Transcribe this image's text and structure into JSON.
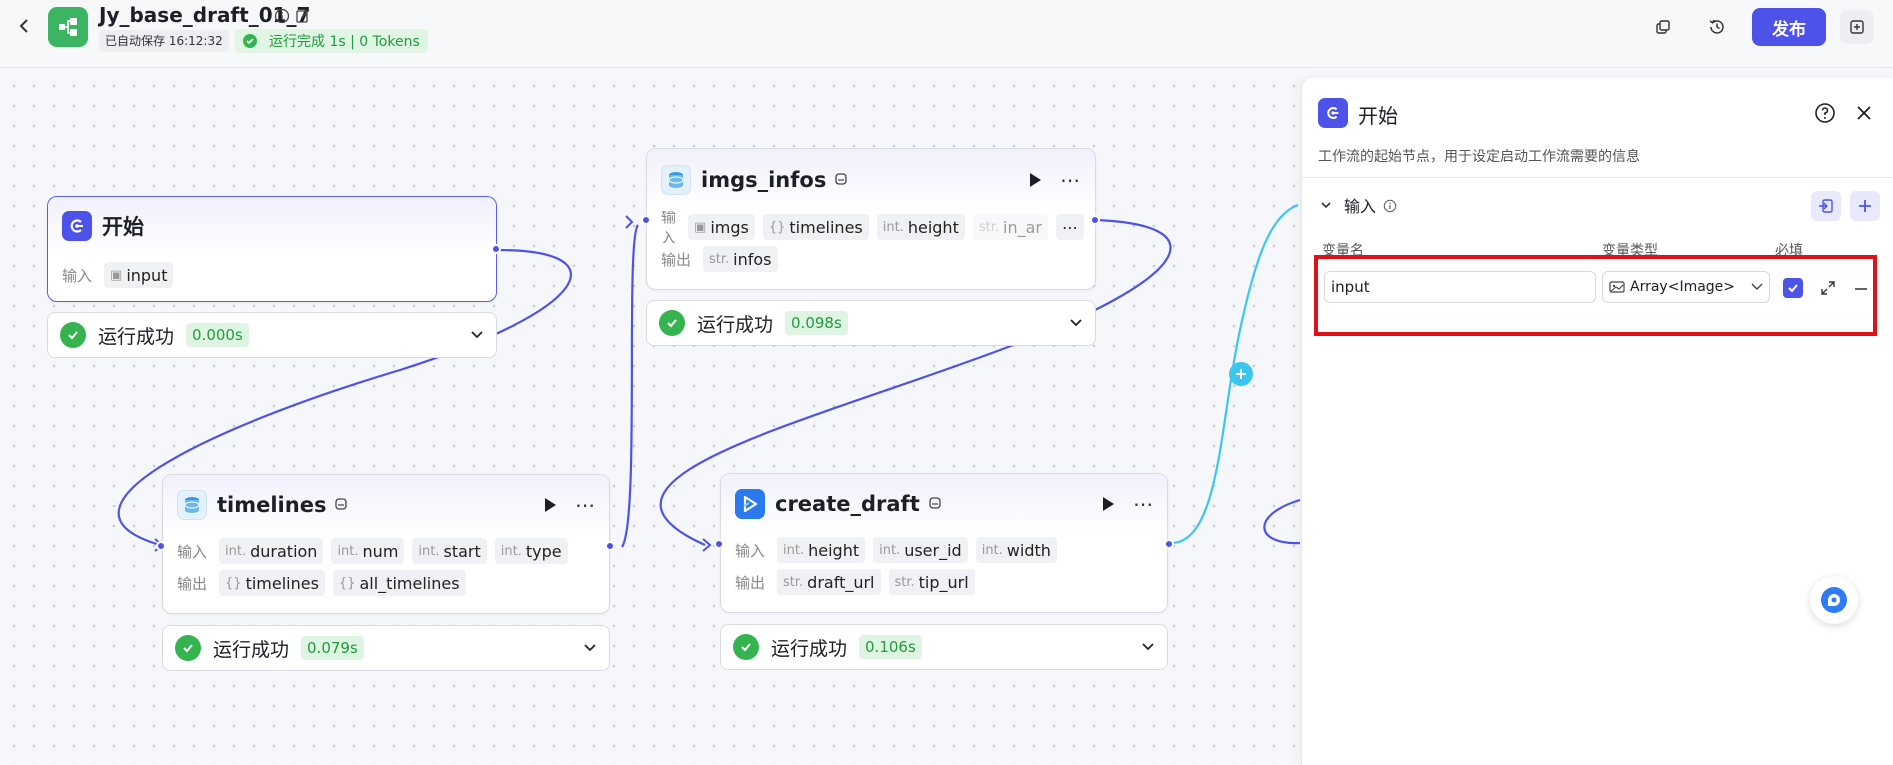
{
  "header": {
    "title": "Jy_base_draft_01_7",
    "autosave": "已自动保存 16:12:32",
    "run_status": "运行完成 1s | 0 Tokens",
    "publish_label": "发布"
  },
  "colors": {
    "accent": "#4d53e8",
    "success": "#34b34f",
    "brand": "#3bb561",
    "wire_cyan": "#3bc6ef",
    "highlight": "#e0111b"
  },
  "labels": {
    "input": "输入",
    "output": "输出",
    "run_success": "运行成功"
  },
  "nodes": {
    "start": {
      "title": "开始",
      "inputs": [
        {
          "type": "img",
          "name": "input"
        }
      ],
      "time": "0.000s"
    },
    "imgs_infos": {
      "title": "imgs_infos",
      "inputs": [
        {
          "type": "img",
          "name": "imgs"
        },
        {
          "type": "{}",
          "name": "timelines"
        },
        {
          "type": "int.",
          "name": "height"
        },
        {
          "type": "str.",
          "name": "in_ar"
        }
      ],
      "outputs": [
        {
          "type": "str.",
          "name": "infos"
        }
      ],
      "time": "0.098s"
    },
    "timelines": {
      "title": "timelines",
      "inputs": [
        {
          "type": "int.",
          "name": "duration"
        },
        {
          "type": "int.",
          "name": "num"
        },
        {
          "type": "int.",
          "name": "start"
        },
        {
          "type": "int.",
          "name": "type"
        }
      ],
      "outputs": [
        {
          "type": "{}",
          "name": "timelines"
        },
        {
          "type": "{}",
          "name": "all_timelines"
        }
      ],
      "time": "0.079s"
    },
    "create_draft": {
      "title": "create_draft",
      "inputs": [
        {
          "type": "int.",
          "name": "height"
        },
        {
          "type": "int.",
          "name": "user_id"
        },
        {
          "type": "int.",
          "name": "width"
        }
      ],
      "outputs": [
        {
          "type": "str.",
          "name": "draft_url"
        },
        {
          "type": "str.",
          "name": "tip_url"
        }
      ],
      "time": "0.106s"
    }
  },
  "panel": {
    "title": "开始",
    "description": "工作流的起始节点，用于设定启动工作流需要的信息",
    "section_title": "输入",
    "col_name": "变量名",
    "col_type": "变量类型",
    "col_required": "必填",
    "var_name": "input",
    "var_type": "Array<Image>",
    "required_checked": true
  }
}
